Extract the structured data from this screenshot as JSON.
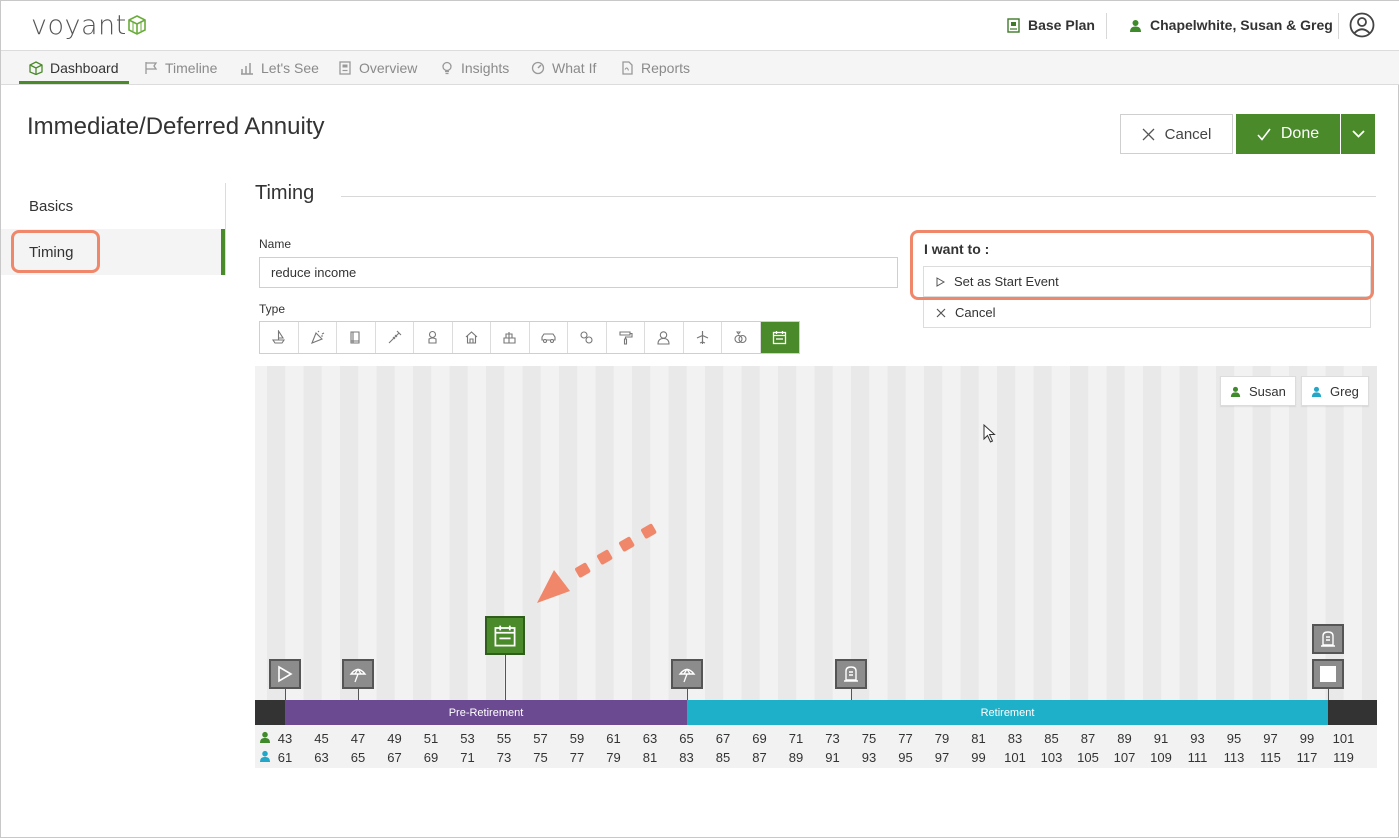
{
  "app": {
    "logo_text": "voyant"
  },
  "header": {
    "plan_label": "Base Plan",
    "client_name": "Chapelwhite, Susan & Greg"
  },
  "nav": [
    {
      "label": "Dashboard",
      "icon": "dashboard-icon",
      "active": true
    },
    {
      "label": "Timeline",
      "icon": "flag-icon"
    },
    {
      "label": "Let's See",
      "icon": "bar-chart-icon"
    },
    {
      "label": "Overview",
      "icon": "document-icon"
    },
    {
      "label": "Insights",
      "icon": "lightbulb-icon"
    },
    {
      "label": "What If",
      "icon": "gauge-icon"
    },
    {
      "label": "Reports",
      "icon": "pdf-icon"
    }
  ],
  "page": {
    "title": "Immediate/Deferred Annuity",
    "cancel_label": "Cancel",
    "done_label": "Done"
  },
  "sidebar": [
    {
      "label": "Basics"
    },
    {
      "label": "Timing",
      "active": true
    }
  ],
  "timing": {
    "section_title": "Timing",
    "name_label": "Name",
    "name_value": "reduce income",
    "type_label": "Type",
    "types": [
      "boat-icon",
      "party-icon",
      "book-icon",
      "medical-icon",
      "baby-icon",
      "house-icon",
      "gift-icon",
      "car-icon",
      "wedding-icon",
      "paint-roller-icon",
      "graduate-icon",
      "airplane-icon",
      "rings-icon",
      "calendar-icon"
    ],
    "selected_type": "calendar-icon"
  },
  "want": {
    "title": "I want to :",
    "options": [
      {
        "label": "Set as Start Event",
        "icon": "play-icon"
      },
      {
        "label": "Cancel",
        "icon": "close-icon"
      }
    ]
  },
  "timeline": {
    "people": [
      {
        "name": "Susan",
        "color": "#3f8a2a"
      },
      {
        "name": "Greg",
        "color": "#22a7c9"
      }
    ],
    "phases": [
      {
        "label": "Pre-Retirement",
        "color": "#6b4a92"
      },
      {
        "label": "Retirement",
        "color": "#1eb0c8"
      }
    ],
    "susan_ages": [
      "43",
      "45",
      "47",
      "49",
      "51",
      "53",
      "55",
      "57",
      "59",
      "61",
      "63",
      "65",
      "67",
      "69",
      "71",
      "73",
      "75",
      "77",
      "79",
      "81",
      "83",
      "85",
      "87",
      "89",
      "91",
      "93",
      "95",
      "97",
      "99",
      "101"
    ],
    "greg_ages": [
      "61",
      "63",
      "65",
      "67",
      "69",
      "71",
      "73",
      "75",
      "77",
      "79",
      "81",
      "83",
      "85",
      "87",
      "89",
      "91",
      "93",
      "95",
      "97",
      "99",
      "101",
      "103",
      "105",
      "107",
      "109",
      "111",
      "113",
      "115",
      "117",
      "119"
    ]
  },
  "colors": {
    "brand_green": "#4a8a2a",
    "highlight": "#f0876a"
  }
}
